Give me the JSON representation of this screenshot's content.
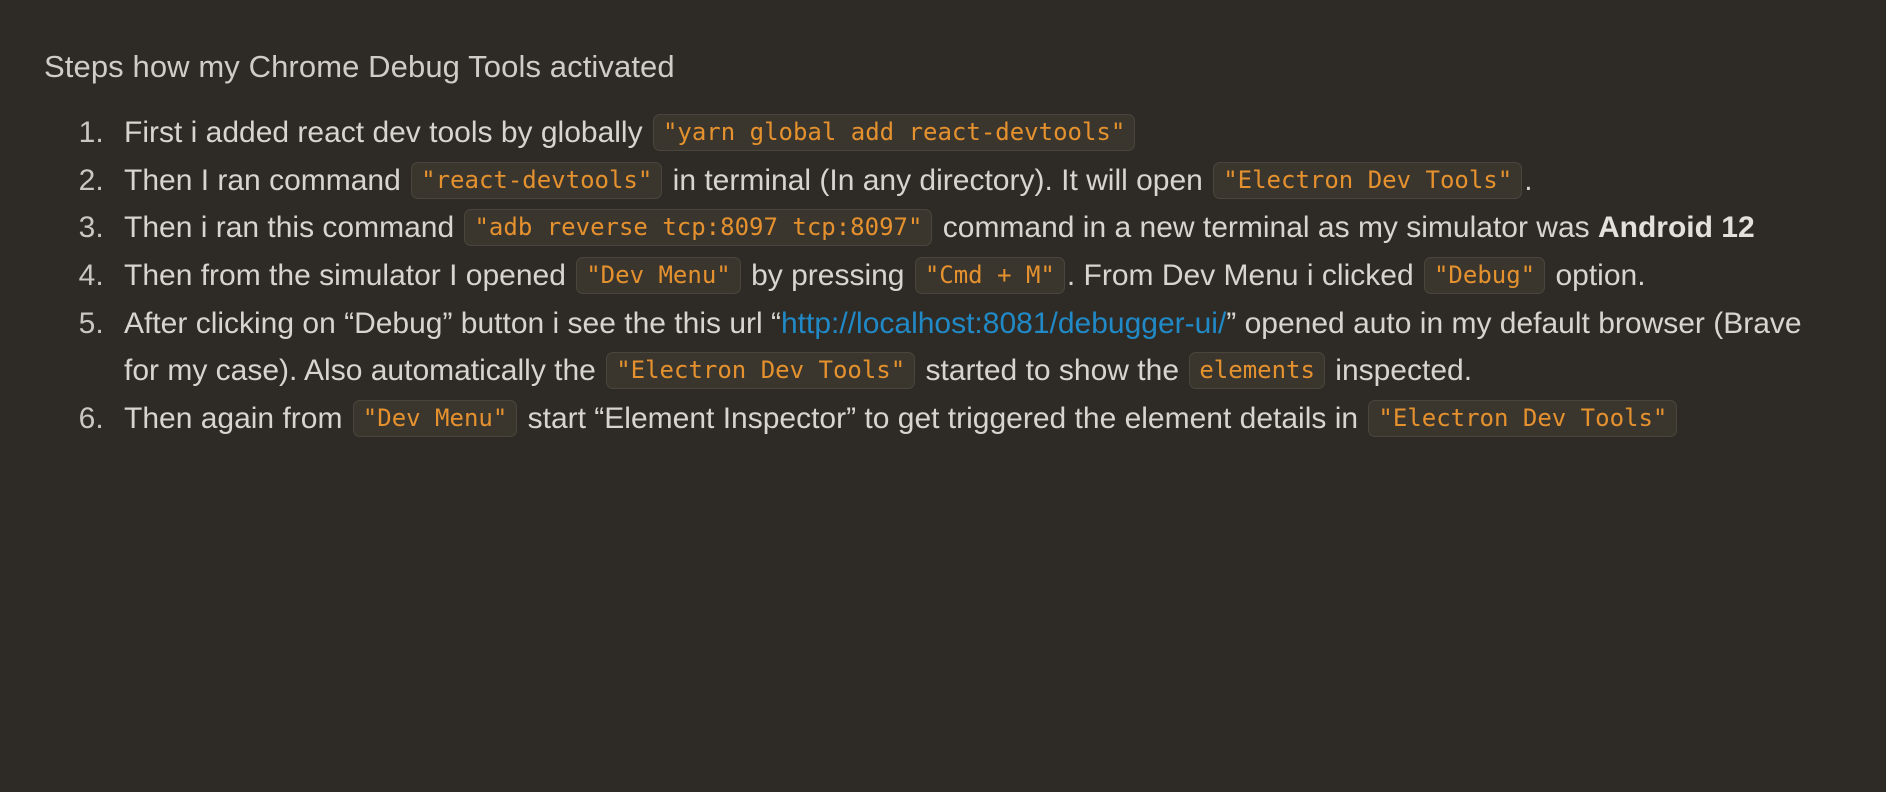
{
  "theme": {
    "background": "#2e2a25",
    "text_color": "#d5d3ce",
    "code_text_color": "#e5912e",
    "code_background": "#3a362e",
    "code_border": "#4a463e",
    "link_color": "#2089c6",
    "bold_color": "#e3e1dc"
  },
  "document": {
    "title": "Steps how my Chrome Debug Tools activated"
  },
  "steps": [
    {
      "number": "1.",
      "parts": [
        {
          "type": "text",
          "value": "First i added react dev tools by globally "
        },
        {
          "type": "code",
          "value": "\"yarn global add react-devtools\""
        }
      ]
    },
    {
      "number": "2.",
      "parts": [
        {
          "type": "text",
          "value": "Then I ran command "
        },
        {
          "type": "code",
          "value": "\"react-devtools\""
        },
        {
          "type": "text",
          "value": " in terminal (In any directory). It will open "
        },
        {
          "type": "code",
          "value": "\"Electron Dev Tools\""
        },
        {
          "type": "text",
          "value": "."
        }
      ]
    },
    {
      "number": "3.",
      "parts": [
        {
          "type": "text",
          "value": "Then i ran this command "
        },
        {
          "type": "code",
          "value": "\"adb reverse tcp:8097 tcp:8097\""
        },
        {
          "type": "text",
          "value": " command in a new terminal as my simulator was "
        },
        {
          "type": "bold",
          "value": "Android 12"
        }
      ]
    },
    {
      "number": "4.",
      "parts": [
        {
          "type": "text",
          "value": "Then from the simulator I opened "
        },
        {
          "type": "code",
          "value": "\"Dev Menu\""
        },
        {
          "type": "text",
          "value": " by pressing "
        },
        {
          "type": "code",
          "value": "\"Cmd + M\""
        },
        {
          "type": "text",
          "value": ". From Dev Menu i clicked "
        },
        {
          "type": "code",
          "value": "\"Debug\""
        },
        {
          "type": "text",
          "value": " option."
        }
      ]
    },
    {
      "number": "5.",
      "parts": [
        {
          "type": "text",
          "value": "After clicking on “Debug” button i see the this url “"
        },
        {
          "type": "link",
          "value": "http://localhost:8081/debugger-ui/"
        },
        {
          "type": "text",
          "value": "” opened auto in my default browser (Brave for my case). Also automatically the "
        },
        {
          "type": "code",
          "value": "\"Electron Dev Tools\""
        },
        {
          "type": "text",
          "value": " started to show the "
        },
        {
          "type": "code",
          "value": "elements"
        },
        {
          "type": "text",
          "value": " inspected."
        }
      ]
    },
    {
      "number": "6.",
      "parts": [
        {
          "type": "text",
          "value": "Then again from "
        },
        {
          "type": "code",
          "value": "\"Dev Menu\""
        },
        {
          "type": "text",
          "value": " start “Element Inspector” to get triggered the element details in "
        },
        {
          "type": "code",
          "value": "\"Electron Dev Tools\""
        }
      ]
    }
  ]
}
